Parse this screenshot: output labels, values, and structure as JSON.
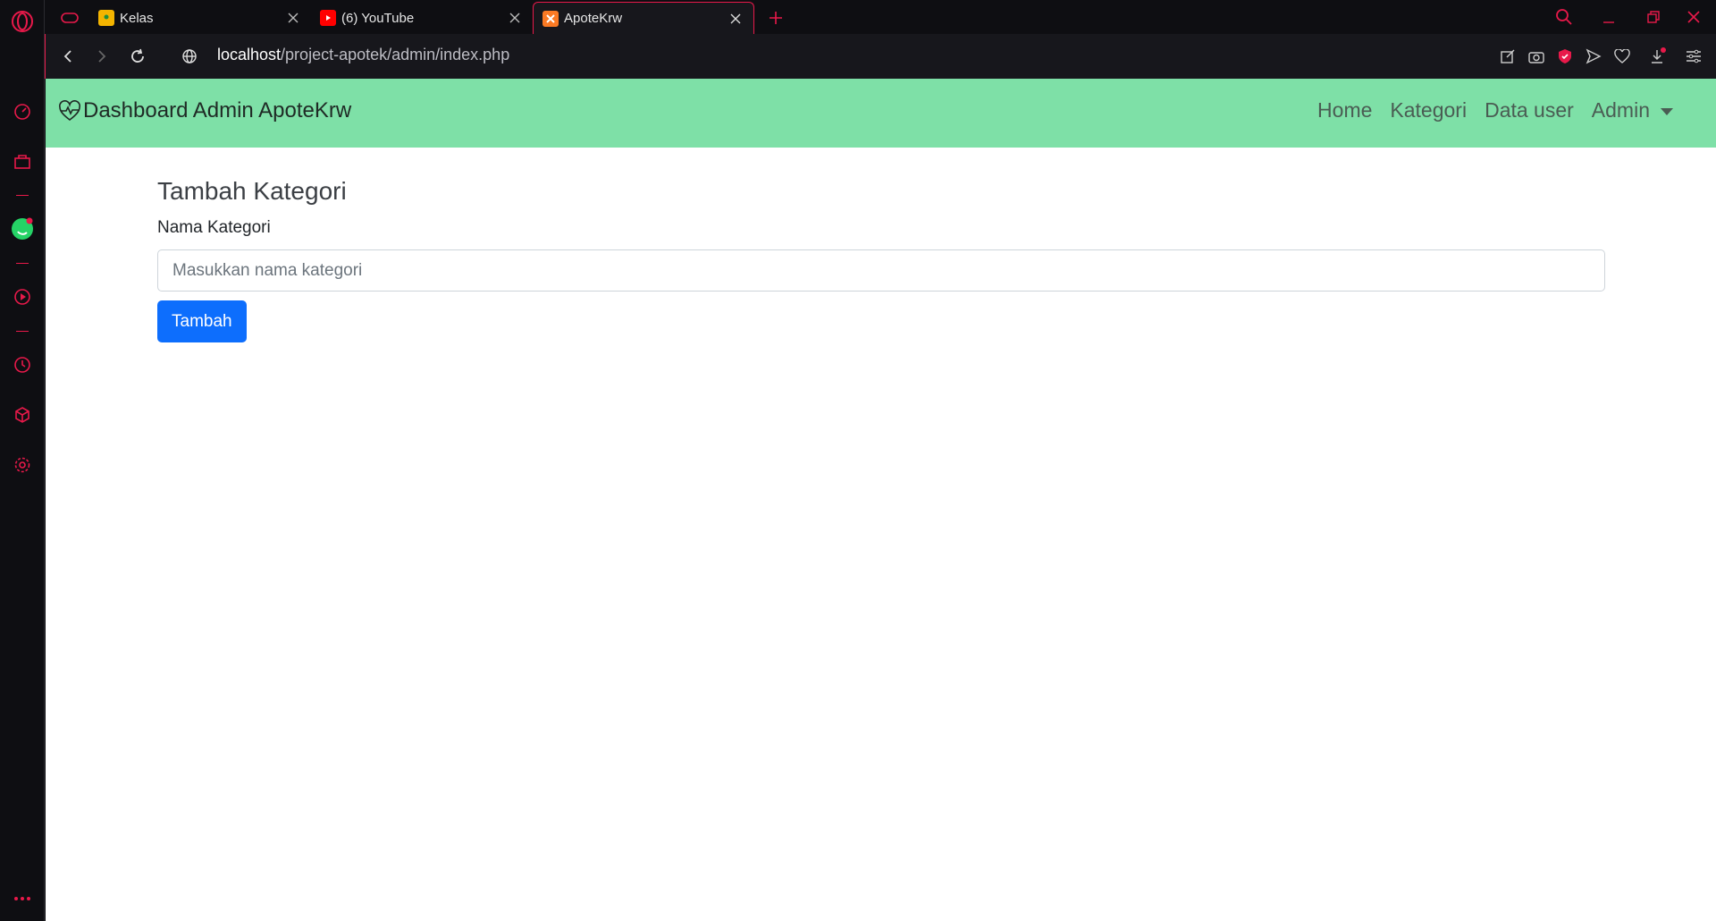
{
  "browser": {
    "tabs": [
      {
        "label": "Kelas",
        "active": false
      },
      {
        "label": "(6) YouTube",
        "active": false
      },
      {
        "label": "ApoteKrw",
        "active": true
      }
    ],
    "url_host": "localhost",
    "url_path": "/project-apotek/admin/index.php"
  },
  "navbar": {
    "brand": "Dashboard Admin ApoteKrw",
    "links": [
      "Home",
      "Kategori",
      "Data user",
      "Admin"
    ]
  },
  "form": {
    "title": "Tambah Kategori",
    "label": "Nama Kategori",
    "placeholder": "Masukkan nama kategori",
    "submit": "Tambah"
  },
  "colors": {
    "accent": "#e8194a",
    "navbar": "#7ee0a7",
    "primary": "#0d6efd"
  }
}
